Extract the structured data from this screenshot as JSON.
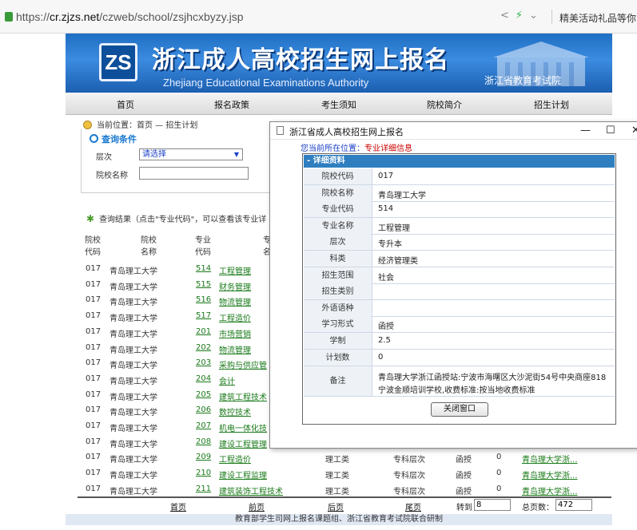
{
  "browser": {
    "url_scheme": "https://",
    "url_host": "cr.zjzs.net",
    "url_path": "/czweb/school/zsjhcxbyzy.jsp",
    "right_text": "精美活动礼品等你"
  },
  "banner": {
    "logo_text": "ZS",
    "title": "浙江成人高校招生网上报名",
    "subtitle": "Zhejiang Educational Examinations Authority",
    "org": "浙江省教育考试院"
  },
  "nav": [
    "首页",
    "报名政策",
    "考生须知",
    "院校简介",
    "招生计划"
  ],
  "breadcrumb": "当前位置：首页 — 招生计划",
  "search": {
    "title": "查询条件",
    "level_label": "层次",
    "level_value": "请选择",
    "school_label": "院校名称",
    "school_value": ""
  },
  "result_note": "查询结果（点击\"专业代码\"，可以查看该专业详",
  "table": {
    "headers": [
      {
        "l1": "院校",
        "l2": "代码"
      },
      {
        "l1": "院校",
        "l2": "名称"
      },
      {
        "l1": "专业",
        "l2": "代码"
      },
      {
        "l1": "专",
        "l2": "名"
      }
    ],
    "rows": [
      {
        "code": "017",
        "school": "青岛理工大学",
        "mcode": "514",
        "major": "工程管理"
      },
      {
        "code": "017",
        "school": "青岛理工大学",
        "mcode": "515",
        "major": "财务管理"
      },
      {
        "code": "017",
        "school": "青岛理工大学",
        "mcode": "516",
        "major": "物流管理"
      },
      {
        "code": "017",
        "school": "青岛理工大学",
        "mcode": "517",
        "major": "工程造价"
      },
      {
        "code": "017",
        "school": "青岛理工大学",
        "mcode": "201",
        "major": "市场营销"
      },
      {
        "code": "017",
        "school": "青岛理工大学",
        "mcode": "202",
        "major": "物流管理"
      },
      {
        "code": "017",
        "school": "青岛理工大学",
        "mcode": "203",
        "major": "采购与供应管"
      },
      {
        "code": "017",
        "school": "青岛理工大学",
        "mcode": "204",
        "major": "会计"
      },
      {
        "code": "017",
        "school": "青岛理工大学",
        "mcode": "205",
        "major": "建筑工程技术"
      },
      {
        "code": "017",
        "school": "青岛理工大学",
        "mcode": "206",
        "major": "数控技术"
      },
      {
        "code": "017",
        "school": "青岛理工大学",
        "mcode": "207",
        "major": "机电一体化技"
      },
      {
        "code": "017",
        "school": "青岛理工大学",
        "mcode": "208",
        "major": "建设工程管理"
      },
      {
        "code": "017",
        "school": "青岛理工大学",
        "mcode": "209",
        "major": "工程造价",
        "type": "理工类",
        "level": "专科层次",
        "form": "函授",
        "num": "0",
        "link": "青岛理大学浙..."
      },
      {
        "code": "017",
        "school": "青岛理工大学",
        "mcode": "210",
        "major": "建设工程监理",
        "type": "理工类",
        "level": "专科层次",
        "form": "函授",
        "num": "0",
        "link": "青岛理大学浙..."
      },
      {
        "code": "017",
        "school": "青岛理工大学",
        "mcode": "211",
        "major": "建筑装饰工程技术",
        "type": "理工类",
        "level": "专科层次",
        "form": "函授",
        "num": "0",
        "link": "青岛理大学浙..."
      }
    ]
  },
  "pager": {
    "first": "首页",
    "prev": "前页",
    "next": "后页",
    "last": "尾页",
    "goto_label": "转到",
    "goto_value": "8",
    "total_label": "总页数：",
    "total_value": "472"
  },
  "footer": "教育部学生司网上报名课题组、浙江省教育考试院联合研制",
  "popup": {
    "window_title": "浙江省成人高校招生网上报名",
    "loc_label": "您当前所在位置：",
    "loc_value": "专业详细信息",
    "section_title": "- 详细资料",
    "fields": [
      {
        "k": "院校代码",
        "v": "017"
      },
      {
        "k": "院校名称",
        "v": "青岛理工大学"
      },
      {
        "k": "专业代码",
        "v": "514"
      },
      {
        "k": "专业名称",
        "v": "工程管理"
      },
      {
        "k": "层次",
        "v": "专升本"
      },
      {
        "k": "科类",
        "v": "经济管理类"
      },
      {
        "k": "招生范围",
        "v": "社会"
      },
      {
        "k": "招生类别",
        "v": ""
      },
      {
        "k": "外语语种",
        "v": ""
      },
      {
        "k": "学习形式",
        "v": "函授"
      },
      {
        "k": "学制",
        "v": "2.5"
      },
      {
        "k": "计划数",
        "v": "0"
      }
    ],
    "note_label": "备注",
    "note_line1": "青岛理大学浙江函授站:宁波市海曙区大沙泥街54号中央商座818",
    "note_line2": "宁波金顺培训学校,收费标准:按当地收费标准",
    "close_label": "关闭窗口"
  }
}
